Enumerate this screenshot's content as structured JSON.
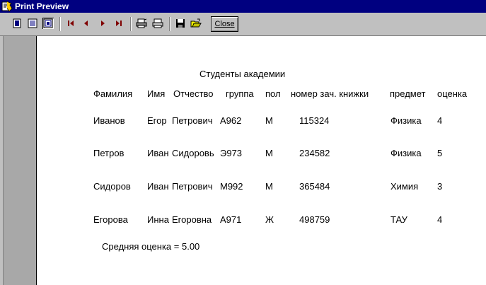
{
  "window": {
    "title": "Print Preview"
  },
  "toolbar": {
    "buttons": [
      {
        "name": "one-page-icon"
      },
      {
        "name": "two-pages-icon"
      },
      {
        "name": "zoom-icon"
      },
      {
        "name": "first-page-icon"
      },
      {
        "name": "previous-page-icon"
      },
      {
        "name": "next-page-icon"
      },
      {
        "name": "last-page-icon"
      },
      {
        "name": "printer-setup-icon"
      },
      {
        "name": "print-icon"
      },
      {
        "name": "save-icon"
      },
      {
        "name": "open-icon"
      }
    ],
    "close_label": "Close"
  },
  "report": {
    "title": "Студенты академии",
    "headers": {
      "surname": "Фамилия",
      "name": "Имя",
      "patronymic": "Отчество",
      "group": "группа",
      "sex": "пол",
      "record_book": "номер зач. книжки",
      "subject": "предмет",
      "grade": "оценка"
    },
    "rows": [
      {
        "surname": "Иванов",
        "name": "Егор",
        "patronymic": "Петрович",
        "group": "А962",
        "sex": "М",
        "record_book": "115324",
        "subject": "Физика",
        "grade": "4"
      },
      {
        "surname": "Петров",
        "name": "Иван",
        "patronymic": "Сидоровь",
        "group": "Э973",
        "sex": "М",
        "record_book": "234582",
        "subject": "Физика",
        "grade": "5"
      },
      {
        "surname": "Сидоров",
        "name": "Иван",
        "patronymic": "Петрович",
        "group": "М992",
        "sex": "М",
        "record_book": "365484",
        "subject": "Химия",
        "grade": "3"
      },
      {
        "surname": "Егорова",
        "name": "Инна",
        "patronymic": "Егоровна",
        "group": "А971",
        "sex": "Ж",
        "record_book": "498759",
        "subject": "ТАУ",
        "grade": "4"
      }
    ],
    "average": "Средняя оценка = 5.00"
  }
}
